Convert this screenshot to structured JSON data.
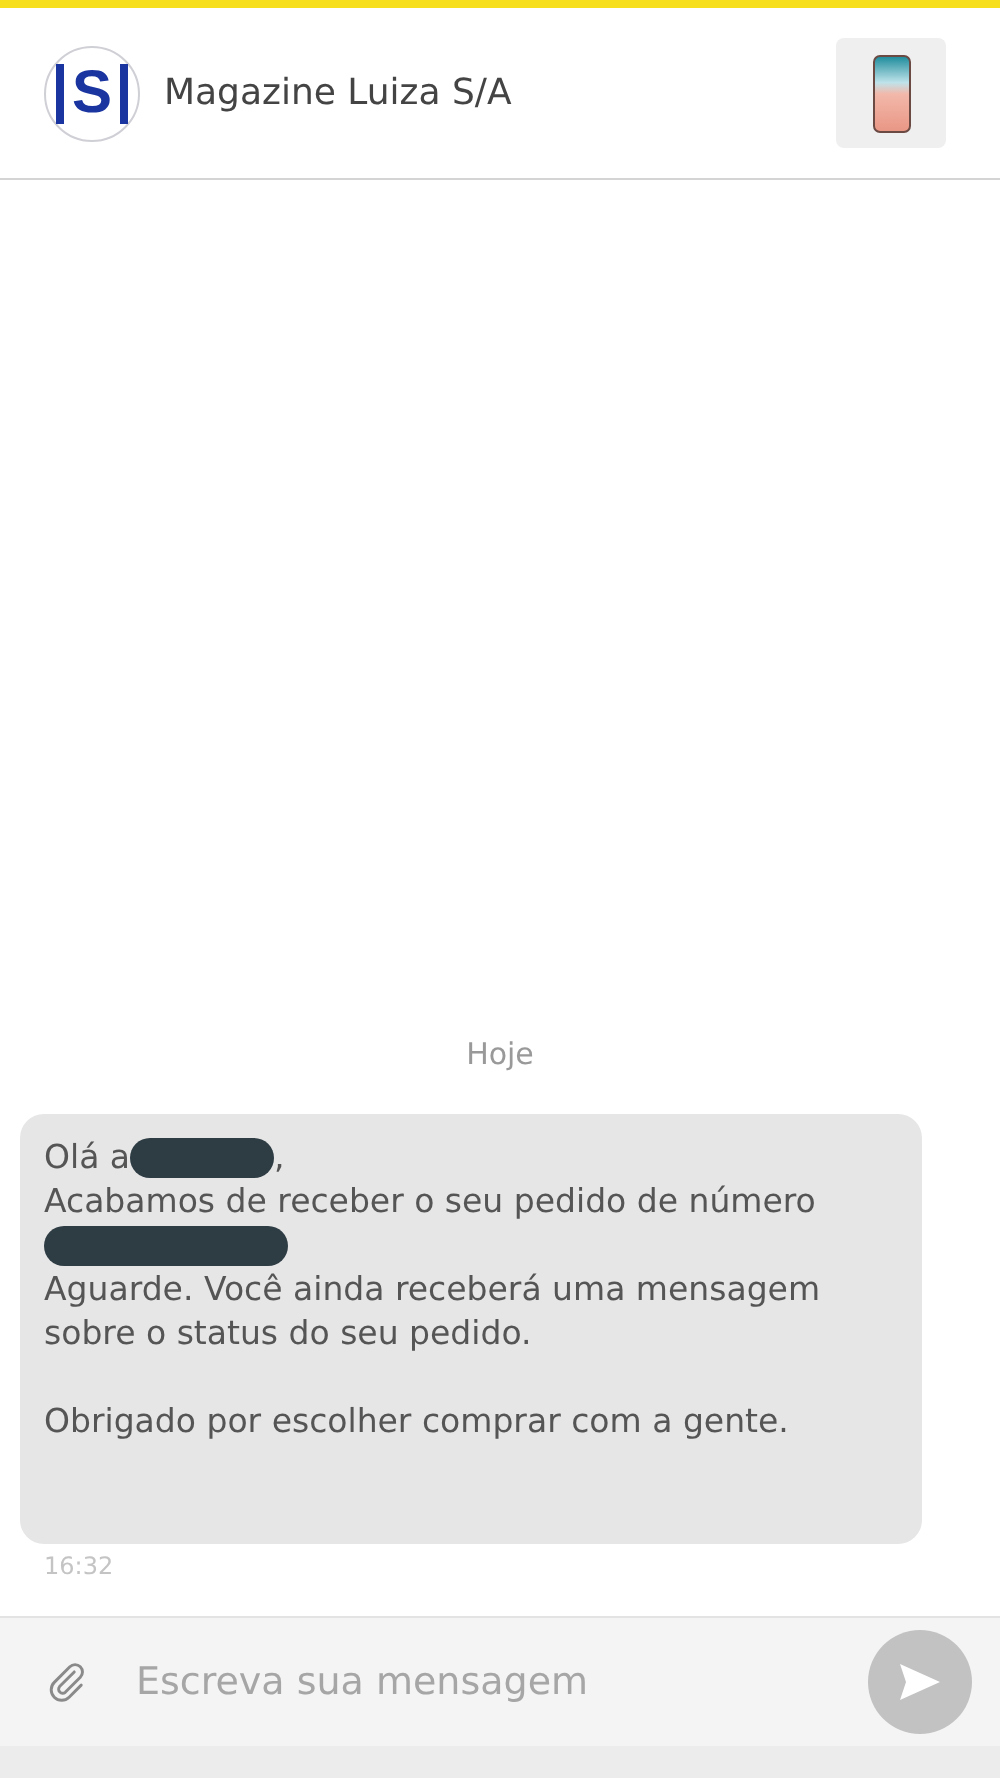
{
  "header": {
    "logo_letter": "S",
    "title": "Magazine Luiza S/A"
  },
  "date_divider": "Hoje",
  "message": {
    "lines": [
      {
        "kind": "redacted",
        "before": "Olá a",
        "after": ","
      },
      {
        "kind": "text",
        "text": "Acabamos de receber o seu pedido de número"
      },
      {
        "kind": "redacted_line"
      },
      {
        "kind": "text",
        "text": "Aguarde. Você ainda receberá uma mensagem sobre o status do seu pedido."
      },
      {
        "kind": "gap"
      },
      {
        "kind": "text",
        "text": "Obrigado por escolher comprar com a gente."
      }
    ],
    "time": "16:32"
  },
  "composer": {
    "placeholder": "Escreva sua mensagem"
  }
}
